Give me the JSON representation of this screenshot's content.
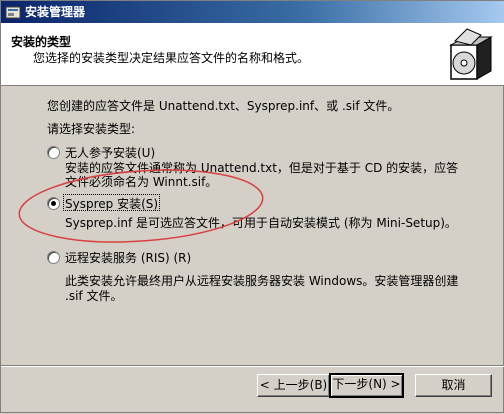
{
  "window": {
    "title": "安装管理器"
  },
  "header": {
    "title": "安装的类型",
    "subtitle": "您选择的安装类型决定结果应答文件的名称和格式。"
  },
  "content": {
    "intro": "您创建的应答文件是 Unattend.txt、Sysprep.inf、或 .sif 文件。",
    "prompt": "请选择安装类型:",
    "options": [
      {
        "label": "无人参予安装(U)",
        "desc_line1": "安装的应答文件通常称为 Unattend.txt，但是对于基于 CD 的安装，应答",
        "desc_line2": "文件必须命名为 Winnt.sif。",
        "selected": false
      },
      {
        "label": "Sysprep 安装(S)",
        "desc_line1": "Sysprep.inf 是可选应答文件，可用于自动安装模式 (称为 Mini-Setup)。",
        "selected": true
      },
      {
        "label": "远程安装服务 (RIS) (R)",
        "desc_line1": "此类安装允许最终用户从远程安装服务器安装 Windows。安装管理器创建",
        "desc_line2": ".sif 文件。",
        "selected": false
      }
    ]
  },
  "buttons": {
    "back": "< 上一步(B)",
    "next": "下一步(N) >",
    "cancel": "取消"
  },
  "annotation": {
    "color": "#d94040"
  }
}
